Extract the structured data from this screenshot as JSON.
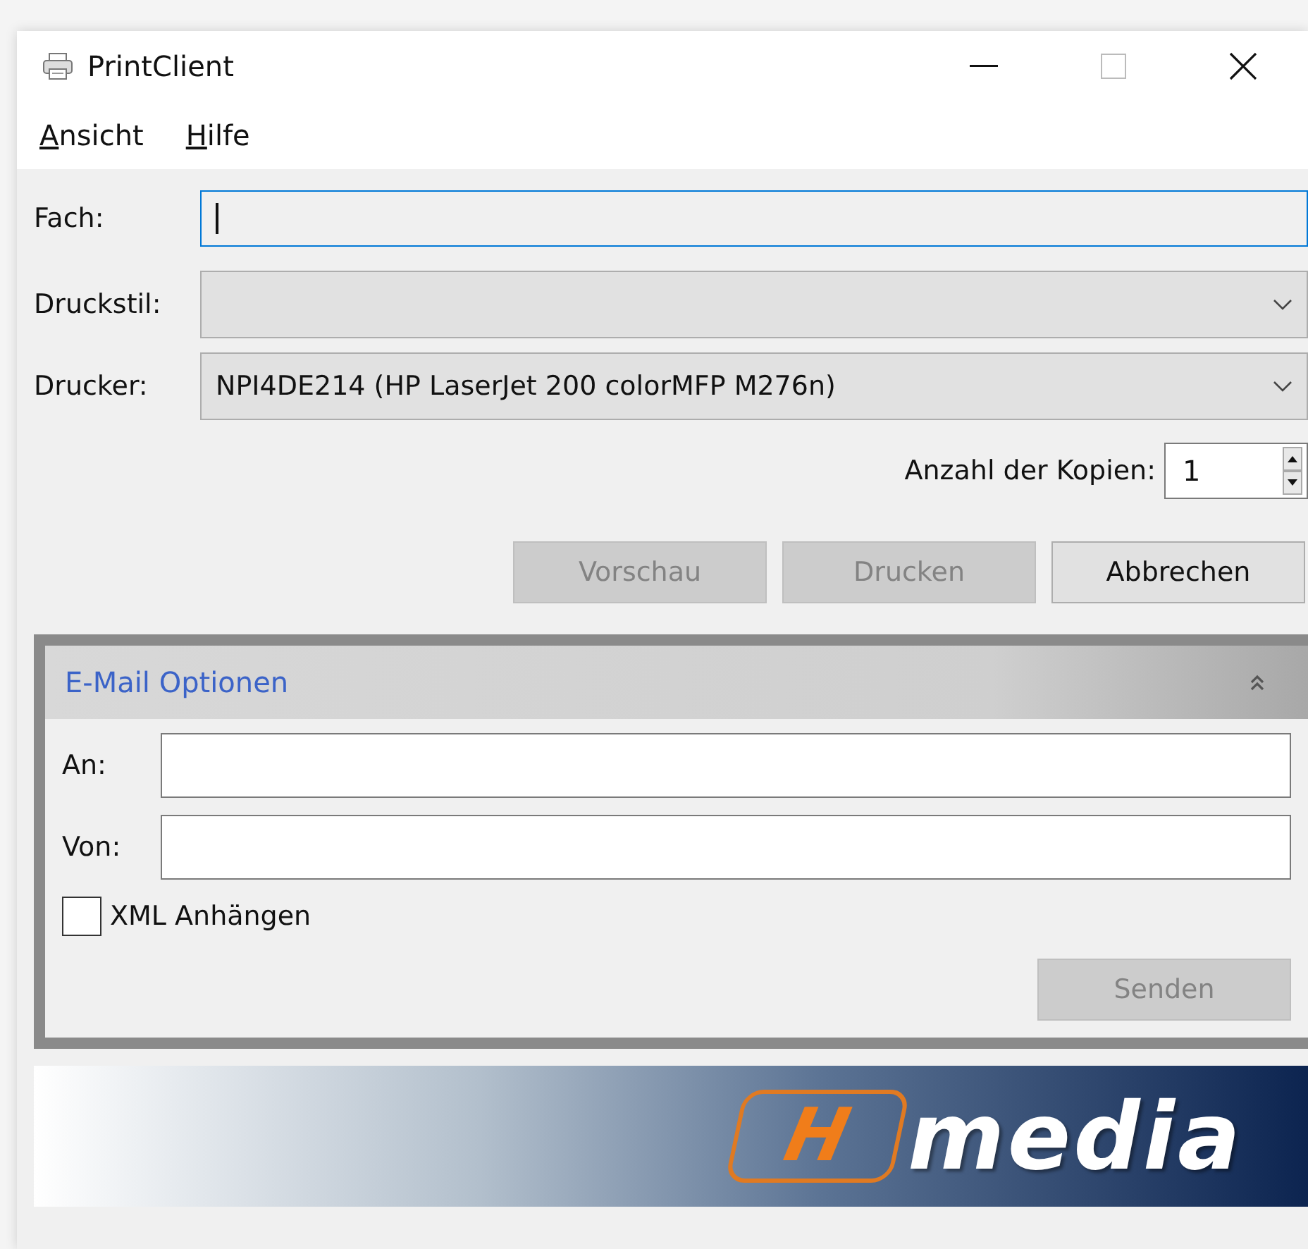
{
  "window": {
    "title": "PrintClient"
  },
  "menu": [
    {
      "label": "Ansicht"
    },
    {
      "label": "Hilfe"
    }
  ],
  "form": [
    {
      "kind": "input",
      "label": "Fach:",
      "focused": true
    },
    {
      "kind": "select",
      "label": "Druckstil:"
    },
    {
      "kind": "select",
      "label": "Drucker:",
      "value": "NPI4DE214 (HP LaserJet 200 colorMFP M276n)"
    }
  ],
  "copies": {
    "label": "Anzahl der Kopien:",
    "value": "1"
  },
  "buttons": [
    {
      "label": "Vorschau",
      "disabled": true
    },
    {
      "label": "Drucken",
      "disabled": true
    },
    {
      "label": "Abbrechen",
      "disabled": false
    }
  ],
  "email_panel": {
    "title": "E-Mail Optionen",
    "expanded": true,
    "fields": [
      {
        "label": "An:"
      },
      {
        "label": "Von:"
      }
    ],
    "checkbox": {
      "label": "XML Anhängen",
      "checked": false
    },
    "send_button": {
      "label": "Senden",
      "disabled": true
    }
  },
  "banner": {
    "logo_mark": "H",
    "logo_text": "media"
  }
}
